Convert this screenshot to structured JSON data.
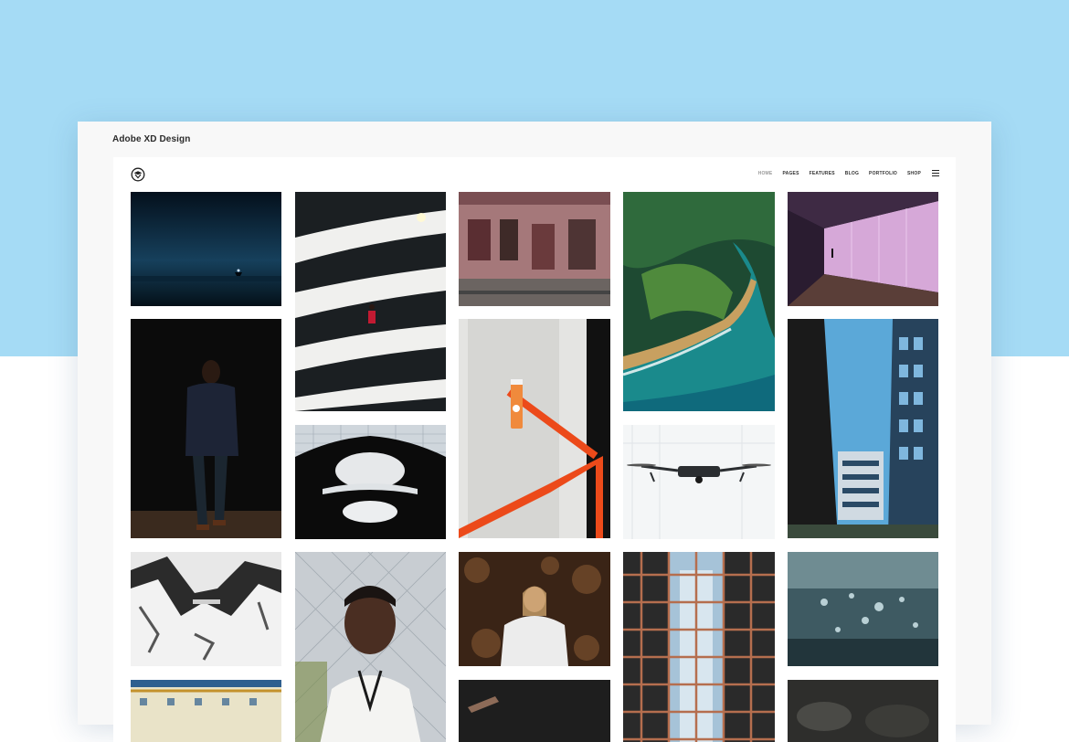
{
  "window": {
    "title": "Adobe XD Design"
  },
  "nav": {
    "items": [
      {
        "label": "HOME",
        "active": true
      },
      {
        "label": "PAGES",
        "active": false
      },
      {
        "label": "FEATURES",
        "active": false
      },
      {
        "label": "BLOG",
        "active": false
      },
      {
        "label": "PORTFOLIO",
        "active": false
      },
      {
        "label": "SHOP",
        "active": false
      }
    ],
    "menu_icon": "hamburger-icon",
    "logo_icon": "fox-logo-icon"
  },
  "gallery": {
    "photos": [
      {
        "name": "night-cyclist-photo"
      },
      {
        "name": "spiral-parking-photo"
      },
      {
        "name": "pink-building-facade-photo"
      },
      {
        "name": "coastal-aerial-photo"
      },
      {
        "name": "purple-tunnel-photo"
      },
      {
        "name": "man-in-dark-photo"
      },
      {
        "name": "juice-bottle-rail-photo"
      },
      {
        "name": "modern-buildings-photo"
      },
      {
        "name": "circular-atrium-photo"
      },
      {
        "name": "drone-photo"
      },
      {
        "name": "snowy-mountains-photo"
      },
      {
        "name": "portrait-man-fence-photo"
      },
      {
        "name": "woman-in-leaves-photo"
      },
      {
        "name": "glass-building-grid-photo"
      },
      {
        "name": "water-splash-photo"
      },
      {
        "name": "tiled-pattern-photo"
      },
      {
        "name": "dark-product-photo"
      },
      {
        "name": "rocks-photo"
      }
    ]
  },
  "colors": {
    "page_background_top": "#a5dbf5",
    "window_background": "#f8f8f8",
    "artboard_background": "#ffffff"
  }
}
